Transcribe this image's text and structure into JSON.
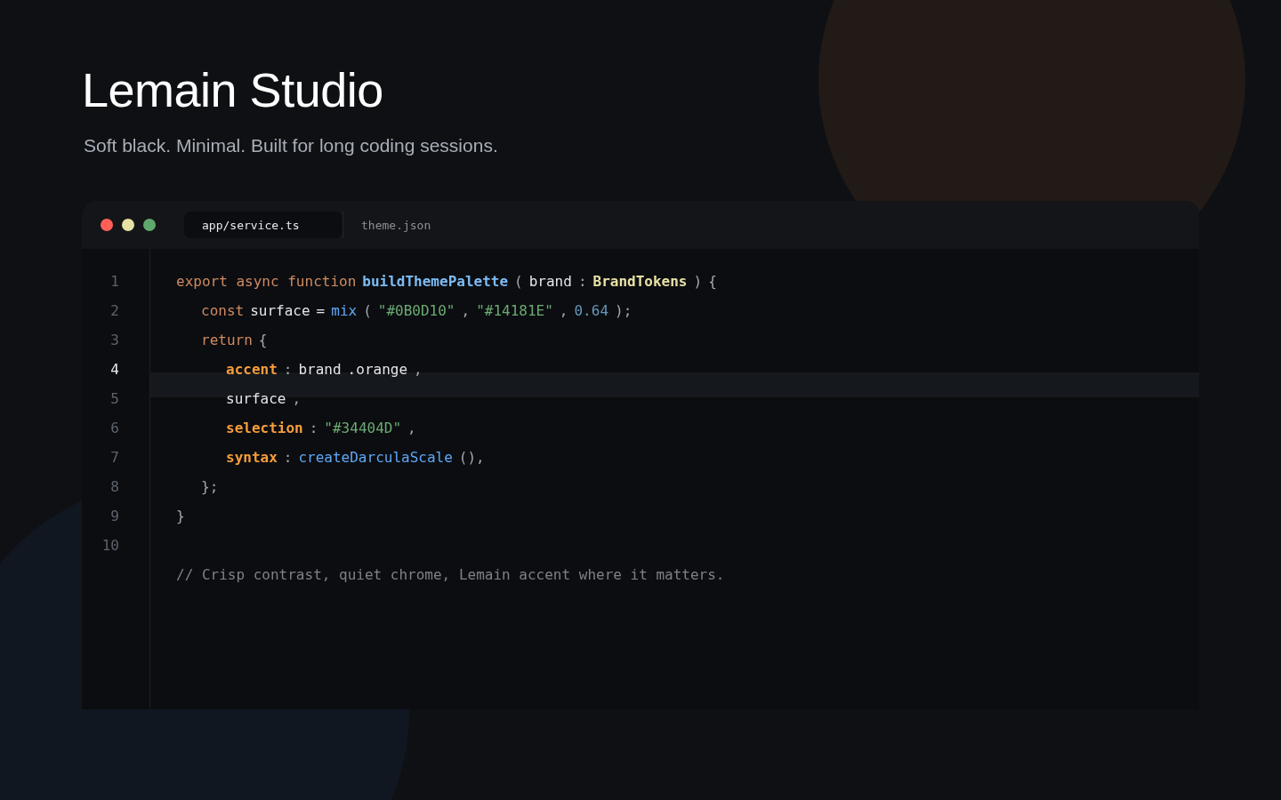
{
  "header": {
    "title": "Lemain Studio",
    "subtitle": "Soft black. Minimal. Built for long coding sessions."
  },
  "window": {
    "controls": [
      {
        "color": "#ff5f57"
      },
      {
        "color": "#e5e0a3"
      },
      {
        "color": "#5fa86c"
      }
    ],
    "tabs": [
      {
        "label": "app/service.ts",
        "selected": true
      },
      {
        "label": "theme.json",
        "selected": false
      }
    ]
  },
  "editor": {
    "lines": [
      {
        "number": "1",
        "current": false,
        "tokens": [
          {
            "kind": "keyword",
            "text": "export async function"
          },
          {
            "kind": "fn",
            "text": "buildThemePalette"
          },
          {
            "kind": "punct",
            "text": "("
          },
          {
            "kind": "plain",
            "text": "brand"
          },
          {
            "kind": "punct",
            "text": ":"
          },
          {
            "kind": "type",
            "text": "BrandTokens"
          },
          {
            "kind": "punct",
            "text": ")"
          },
          {
            "kind": "punct",
            "text": "{"
          }
        ],
        "children": [
          {
            "number": "2",
            "current": false,
            "tokens": [
              {
                "kind": "keyword",
                "text": "const"
              },
              {
                "kind": "plain",
                "text": "surface"
              },
              {
                "kind": "plain",
                "text": "="
              },
              {
                "kind": "call",
                "text": "mix"
              },
              {
                "kind": "punct",
                "text": "("
              },
              {
                "kind": "string",
                "text": "\"#0B0D10\""
              },
              {
                "kind": "punct",
                "text": ","
              },
              {
                "kind": "string",
                "text": "\"#14181E\""
              },
              {
                "kind": "punct",
                "text": ","
              },
              {
                "kind": "number",
                "text": "0.64"
              },
              {
                "kind": "punct",
                "text": ");"
              }
            ]
          },
          {
            "number": "3",
            "current": false,
            "tokens": [
              {
                "kind": "keyword",
                "text": "return"
              },
              {
                "kind": "punct",
                "text": "{"
              }
            ],
            "children": [
              {
                "number": "4",
                "current": true,
                "tokens": [
                  {
                    "kind": "prop",
                    "text": "accent"
                  },
                  {
                    "kind": "punct",
                    "text": ":"
                  },
                  {
                    "kind": "plain",
                    "text": "brand"
                  },
                  {
                    "kind": "plain",
                    "text": ".orange"
                  },
                  {
                    "kind": "punct",
                    "text": ","
                  }
                ]
              },
              {
                "number": "5",
                "current": false,
                "tokens": [
                  {
                    "kind": "plain",
                    "text": "surface"
                  },
                  {
                    "kind": "punct",
                    "text": ","
                  }
                ]
              },
              {
                "number": "6",
                "current": false,
                "tokens": [
                  {
                    "kind": "prop",
                    "text": "selection"
                  },
                  {
                    "kind": "punct",
                    "text": ":"
                  },
                  {
                    "kind": "string",
                    "text": "\"#34404D\""
                  },
                  {
                    "kind": "punct",
                    "text": ","
                  }
                ]
              },
              {
                "number": "7",
                "current": false,
                "tokens": [
                  {
                    "kind": "prop",
                    "text": "syntax"
                  },
                  {
                    "kind": "punct",
                    "text": ":"
                  },
                  {
                    "kind": "call",
                    "text": "createDarculaScale"
                  },
                  {
                    "kind": "punct",
                    "text": "(),"
                  }
                ]
              }
            ]
          },
          {
            "number": "8",
            "current": false,
            "tokens": [
              {
                "kind": "punct",
                "text": "};"
              }
            ]
          }
        ]
      },
      {
        "number": "9",
        "current": false,
        "tokens": [
          {
            "kind": "punct",
            "text": "}"
          }
        ]
      },
      {
        "number": "10",
        "current": false
      },
      {
        "tokens": [
          {
            "kind": "comment",
            "text": "// Crisp contrast, quiet chrome, Lemain accent where it matters."
          }
        ]
      }
    ]
  }
}
